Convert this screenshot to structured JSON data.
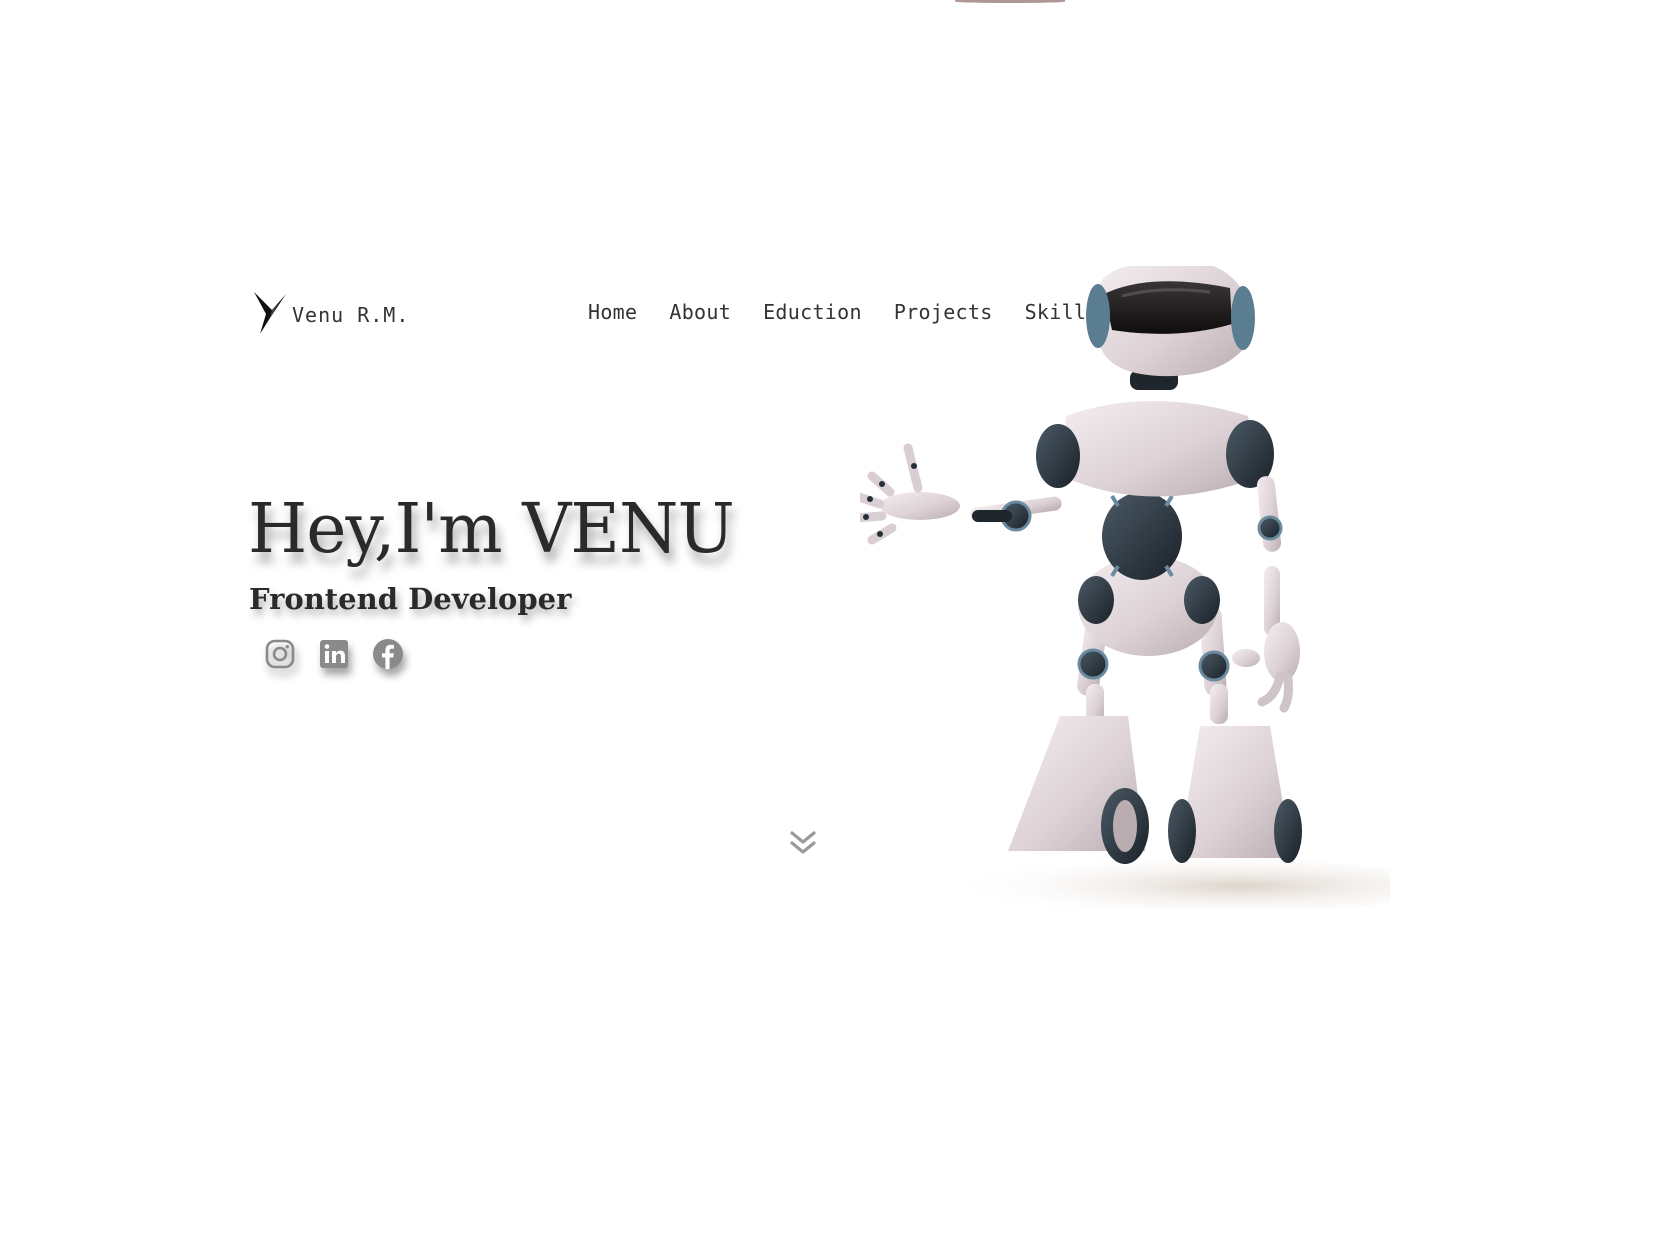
{
  "brand": {
    "logo_icon": "y-logo-icon",
    "name": "Venu R.M."
  },
  "nav": {
    "items": [
      "Home",
      "About",
      "Eduction",
      "Projects",
      "Skills"
    ]
  },
  "hero": {
    "title": "Hey,I'm VENU",
    "subtitle": "Frontend Developer"
  },
  "socials": [
    "instagram-icon",
    "linkedin-icon",
    "facebook-icon"
  ],
  "scroll": {
    "icon": "double-chevron-down-icon"
  },
  "colors": {
    "text": "#2a2a2a",
    "icon_gray": "#8a8a8a",
    "background": "#ffffff"
  }
}
